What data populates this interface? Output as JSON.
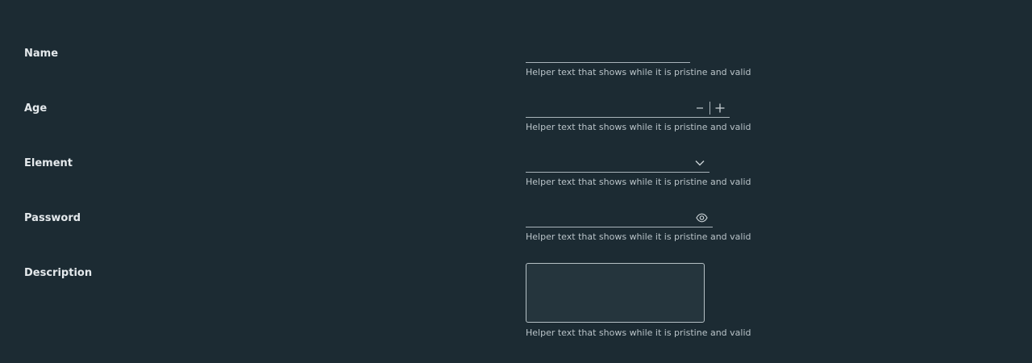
{
  "form": {
    "fields": {
      "name": {
        "label": "Name",
        "value": "",
        "helper": "Helper text that shows while it is pristine and valid"
      },
      "age": {
        "label": "Age",
        "value": "",
        "helper": "Helper text that shows while it is pristine and valid",
        "decrement_icon": "minus-icon",
        "increment_icon": "plus-icon"
      },
      "element": {
        "label": "Element",
        "value": "",
        "helper": "Helper text that shows while it is pristine and valid",
        "icon": "chevron-down-icon"
      },
      "password": {
        "label": "Password",
        "value": "",
        "helper": "Helper text that shows while it is pristine and valid",
        "icon": "eye-icon"
      },
      "description": {
        "label": "Description",
        "value": "",
        "helper": "Helper text that shows while it is pristine and valid"
      }
    }
  },
  "colors": {
    "background": "#1c2b33",
    "field_line": "#a9b4ba",
    "textarea_bg": "#25353d",
    "label_text": "#e4e9ec",
    "helper_text": "#b9c3c8"
  }
}
